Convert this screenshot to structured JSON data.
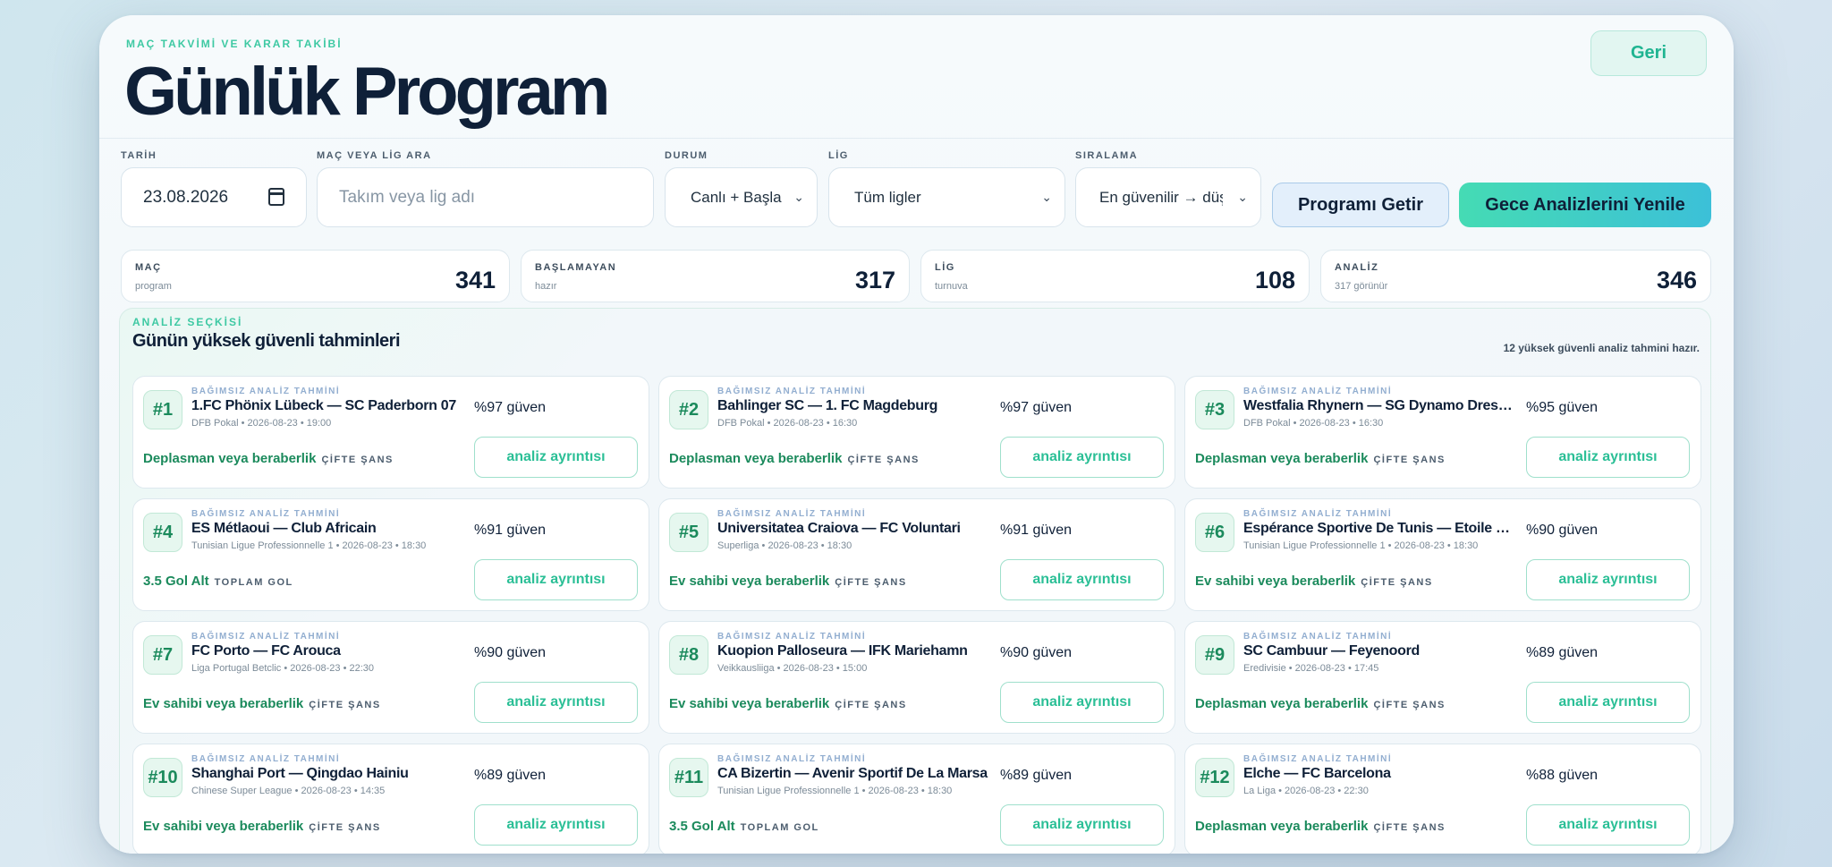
{
  "header": {
    "eyebrow": "MAÇ TAKVİMİ VE KARAR TAKİBİ",
    "title": "Günlük Program",
    "back_label": "Geri"
  },
  "filters": {
    "date_label": "TARİH",
    "date_value": "23.08.2026",
    "search_label": "MAÇ VEYA LİG ARA",
    "search_placeholder": "Takım veya lig adı",
    "status_label": "DURUM",
    "status_value": "Canlı + Başla",
    "league_label": "LİG",
    "league_value": "Tüm ligler",
    "sort_label": "SIRALAMA",
    "sort_value": "En güvenilir → düş",
    "fetch_label": "Programı Getir",
    "refresh_label": "Gece Analizlerini Yenile"
  },
  "stats": [
    {
      "label": "MAÇ",
      "sub": "program",
      "value": "341"
    },
    {
      "label": "BAŞLAMAYAN",
      "sub": "hazır",
      "value": "317"
    },
    {
      "label": "LİG",
      "sub": "turnuva",
      "value": "108"
    },
    {
      "label": "ANALİZ",
      "sub": "317 görünür",
      "value": "346"
    }
  ],
  "picks": {
    "eyebrow": "ANALİZ SEÇKİSİ",
    "title": "Günün yüksek güvenli tahminleri",
    "count_text": "12 yüksek güvenli analiz tahmini hazır.",
    "tag": "BAĞIMSIZ ANALİZ TAHMİNİ",
    "detail_label": "analiz ayrıntısı",
    "items": [
      {
        "rank": "#1",
        "match": "1.FC Phönix Lübeck — SC Paderborn 07",
        "meta": "DFB Pokal • 2026-08-23 • 19:00",
        "confidence": "%97 güven",
        "prediction": "Deplasman veya beraberlik",
        "type": "ÇİFTE ŞANS"
      },
      {
        "rank": "#2",
        "match": "Bahlinger SC — 1. FC Magdeburg",
        "meta": "DFB Pokal • 2026-08-23 • 16:30",
        "confidence": "%97 güven",
        "prediction": "Deplasman veya beraberlik",
        "type": "ÇİFTE ŞANS"
      },
      {
        "rank": "#3",
        "match": "Westfalia Rhynern — SG Dynamo Dresden",
        "meta": "DFB Pokal • 2026-08-23 • 16:30",
        "confidence": "%95 güven",
        "prediction": "Deplasman veya beraberlik",
        "type": "ÇİFTE ŞANS"
      },
      {
        "rank": "#4",
        "match": "ES Métlaoui — Club Africain",
        "meta": "Tunisian Ligue Professionnelle 1 • 2026-08-23 • 18:30",
        "confidence": "%91 güven",
        "prediction": "3.5 Gol Alt",
        "type": "TOPLAM GOL"
      },
      {
        "rank": "#5",
        "match": "Universitatea Craiova — FC Voluntari",
        "meta": "Superliga • 2026-08-23 • 18:30",
        "confidence": "%91 güven",
        "prediction": "Ev sahibi veya beraberlik",
        "type": "ÇİFTE ŞANS"
      },
      {
        "rank": "#6",
        "match": "Espérance Sportive De Tunis — Etoile Sportive du Sahel",
        "meta": "Tunisian Ligue Professionnelle 1 • 2026-08-23 • 18:30",
        "confidence": "%90 güven",
        "prediction": "Ev sahibi veya beraberlik",
        "type": "ÇİFTE ŞANS"
      },
      {
        "rank": "#7",
        "match": "FC Porto — FC Arouca",
        "meta": "Liga Portugal Betclic • 2026-08-23 • 22:30",
        "confidence": "%90 güven",
        "prediction": "Ev sahibi veya beraberlik",
        "type": "ÇİFTE ŞANS"
      },
      {
        "rank": "#8",
        "match": "Kuopion Palloseura — IFK Mariehamn",
        "meta": "Veikkausliiga • 2026-08-23 • 15:00",
        "confidence": "%90 güven",
        "prediction": "Ev sahibi veya beraberlik",
        "type": "ÇİFTE ŞANS"
      },
      {
        "rank": "#9",
        "match": "SC Cambuur — Feyenoord",
        "meta": "Eredivisie • 2026-08-23 • 17:45",
        "confidence": "%89 güven",
        "prediction": "Deplasman veya beraberlik",
        "type": "ÇİFTE ŞANS"
      },
      {
        "rank": "#10",
        "match": "Shanghai Port — Qingdao Hainiu",
        "meta": "Chinese Super League • 2026-08-23 • 14:35",
        "confidence": "%89 güven",
        "prediction": "Ev sahibi veya beraberlik",
        "type": "ÇİFTE ŞANS"
      },
      {
        "rank": "#11",
        "match": "CA Bizertin — Avenir Sportif De La Marsa",
        "meta": "Tunisian Ligue Professionnelle 1 • 2026-08-23 • 18:30",
        "confidence": "%89 güven",
        "prediction": "3.5 Gol Alt",
        "type": "TOPLAM GOL"
      },
      {
        "rank": "#12",
        "match": "Elche — FC Barcelona",
        "meta": "La Liga • 2026-08-23 • 22:30",
        "confidence": "%88 güven",
        "prediction": "Deplasman veya beraberlik",
        "type": "ÇİFTE ŞANS"
      }
    ]
  }
}
